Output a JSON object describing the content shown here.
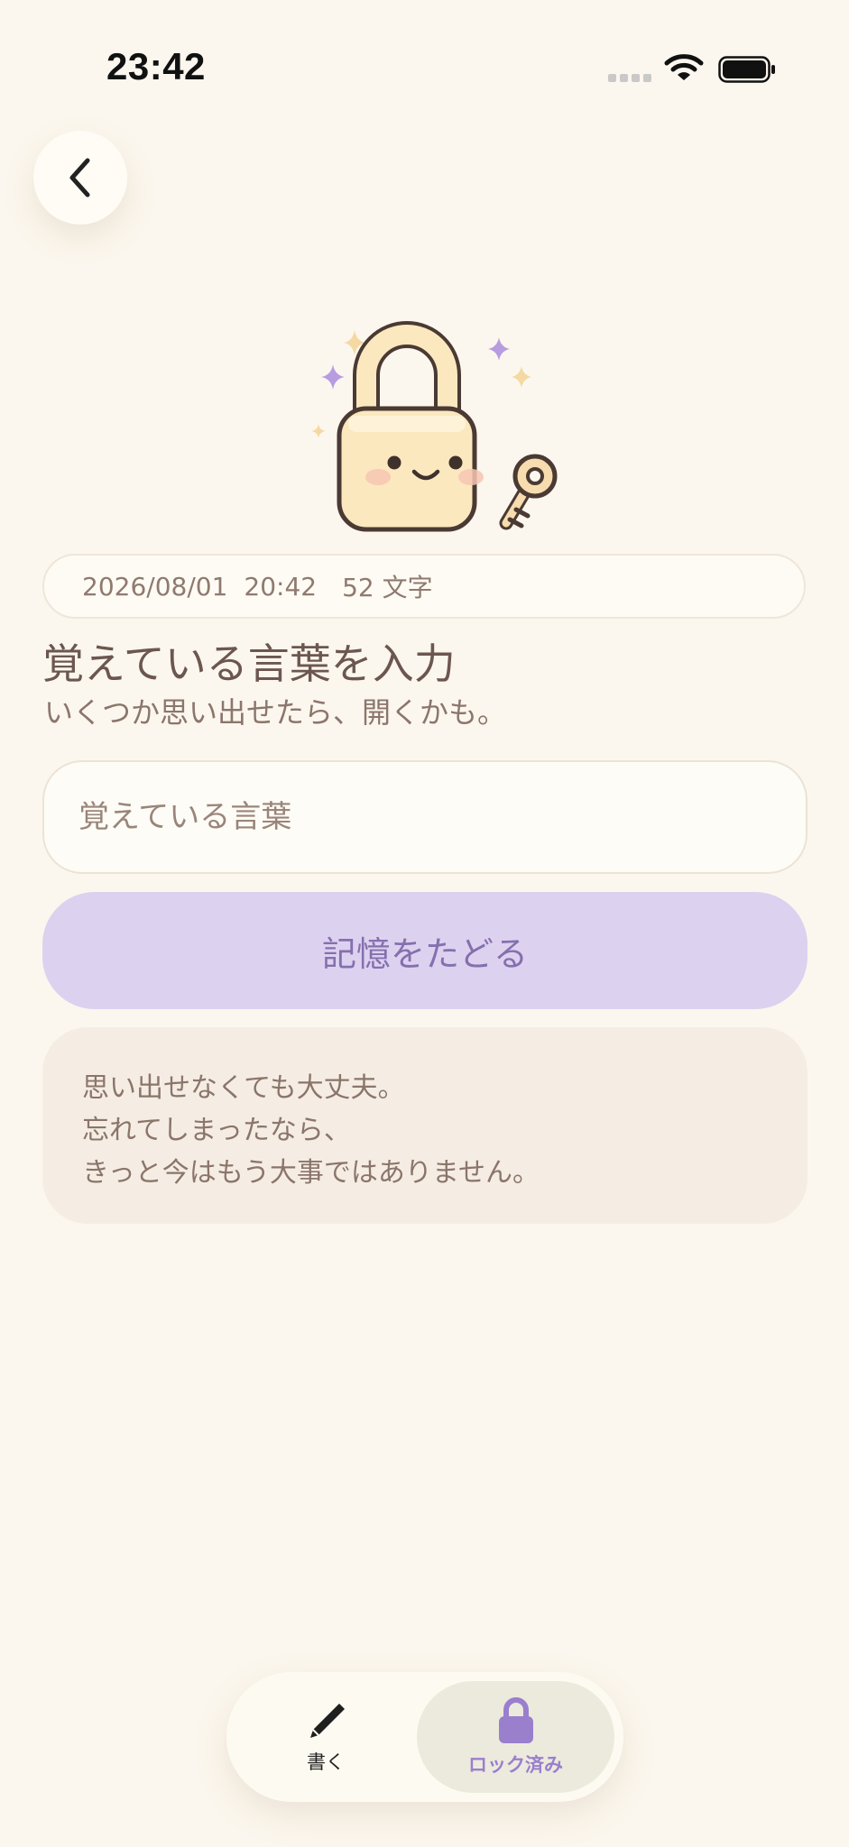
{
  "status_bar": {
    "time": "23:42",
    "icons": [
      "signal-dots",
      "wifi-icon",
      "battery-icon"
    ]
  },
  "header": {
    "back_icon": "chevron-left-icon"
  },
  "illustration": {
    "icon": "smiling-padlock-with-key-illustration"
  },
  "meta": {
    "date": "2026/08/01",
    "time": "20:42",
    "char_count": "52 文字"
  },
  "prompt": {
    "title": "覚えている言葉を入力",
    "subtitle": "いくつか思い出せたら、開くかも。"
  },
  "input": {
    "placeholder": "覚えている言葉",
    "value": ""
  },
  "action": {
    "trace_label": "記憶をたどる"
  },
  "note": {
    "lines": [
      "思い出せなくても大丈夫。",
      "忘れてしまったなら、",
      "きっと今はもう大事ではありません。"
    ]
  },
  "tab_bar": {
    "tabs": [
      {
        "label": "書く",
        "icon": "pencil-icon",
        "active": false
      },
      {
        "label": "ロック済み",
        "icon": "lock-icon",
        "active": true
      }
    ]
  },
  "colors": {
    "background": "#fcf7ee",
    "accent_purple": "#9a7fcd",
    "button_purple": "#ddd1f0",
    "text_brown": "#6c5750",
    "lock_body": "#fbe8bf"
  }
}
